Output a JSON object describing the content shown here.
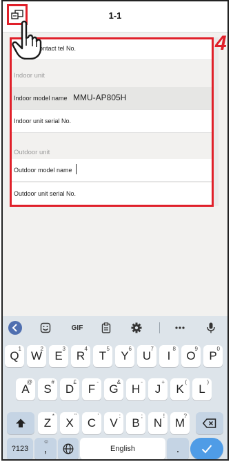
{
  "header": {
    "title": "1-1"
  },
  "annotation": {
    "callout_number": "4"
  },
  "form": {
    "contact_row_label": "Service contact tel No.",
    "indoor_section": "Indoor unit",
    "indoor_model_label": "Indoor model name",
    "indoor_model_value": "MMU-AP805H",
    "indoor_serial_label": "Indoor unit serial No.",
    "outdoor_section": "Outdoor unit",
    "outdoor_model_label": "Outdoor model name",
    "outdoor_model_value": "",
    "outdoor_serial_label": "Outdoor unit serial No."
  },
  "keyboard": {
    "toolbar": {
      "gif_label": "GIF"
    },
    "row1": [
      {
        "key": "Q",
        "sub": "1"
      },
      {
        "key": "W",
        "sub": "2"
      },
      {
        "key": "E",
        "sub": "3"
      },
      {
        "key": "R",
        "sub": "4"
      },
      {
        "key": "T",
        "sub": "5"
      },
      {
        "key": "Y",
        "sub": "6"
      },
      {
        "key": "U",
        "sub": "7"
      },
      {
        "key": "I",
        "sub": "8"
      },
      {
        "key": "O",
        "sub": "9"
      },
      {
        "key": "P",
        "sub": "0"
      }
    ],
    "row2": [
      {
        "key": "A",
        "sub": "@"
      },
      {
        "key": "S",
        "sub": "#"
      },
      {
        "key": "D",
        "sub": "£"
      },
      {
        "key": "F",
        "sub": "-"
      },
      {
        "key": "G",
        "sub": "&"
      },
      {
        "key": "H",
        "sub": "-"
      },
      {
        "key": "J",
        "sub": "+"
      },
      {
        "key": "K",
        "sub": "("
      },
      {
        "key": "L",
        "sub": ")"
      }
    ],
    "row3": [
      {
        "key": "Z",
        "sub": "*"
      },
      {
        "key": "X",
        "sub": "\""
      },
      {
        "key": "C",
        "sub": "'"
      },
      {
        "key": "V",
        "sub": ":"
      },
      {
        "key": "B",
        "sub": ";"
      },
      {
        "key": "N",
        "sub": "!"
      },
      {
        "key": "M",
        "sub": "?"
      }
    ],
    "symbols_label": "?123",
    "comma_key": ",",
    "comma_sub": "☺",
    "space_label": "English",
    "period_key": "."
  },
  "colors": {
    "accent": "#e0202a",
    "keyboard_bg": "#dde4ea",
    "enter_key": "#4f9ce6"
  }
}
